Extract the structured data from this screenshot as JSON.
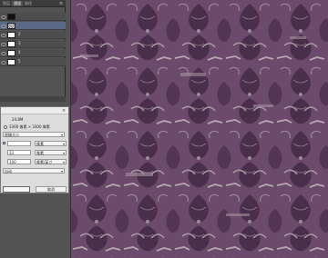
{
  "layers_panel": {
    "tabs": [
      "图层",
      "通道",
      "路径"
    ],
    "layers": [
      {
        "name": "",
        "extra": "",
        "thumb": "dark"
      },
      {
        "name": "",
        "extra": "",
        "thumb": "pattern",
        "selected": true
      },
      {
        "name": "2",
        "extra": "",
        "thumb": "white"
      },
      {
        "name": "3",
        "extra": "",
        "thumb": "white"
      },
      {
        "name": "4",
        "extra": "",
        "thumb": "white"
      },
      {
        "name": "5",
        "extra": "",
        "thumb": "white"
      }
    ]
  },
  "dialog": {
    "image_size": "24.8M",
    "dimensions": "3300 像素 × 3300 像素",
    "fit_to": "原稿大小",
    "width_value": "",
    "width_unit": "像素",
    "height_value": "33",
    "height_unit": "像素",
    "resolution_value": "100",
    "resolution_unit": "像素/英寸",
    "resample": "自动",
    "ok_label": "",
    "cancel_label": "取消"
  },
  "canvas": {
    "base_color": "#6c4a6b",
    "dark_color": "#4a2f4b",
    "light_color": "#9a8a95"
  }
}
